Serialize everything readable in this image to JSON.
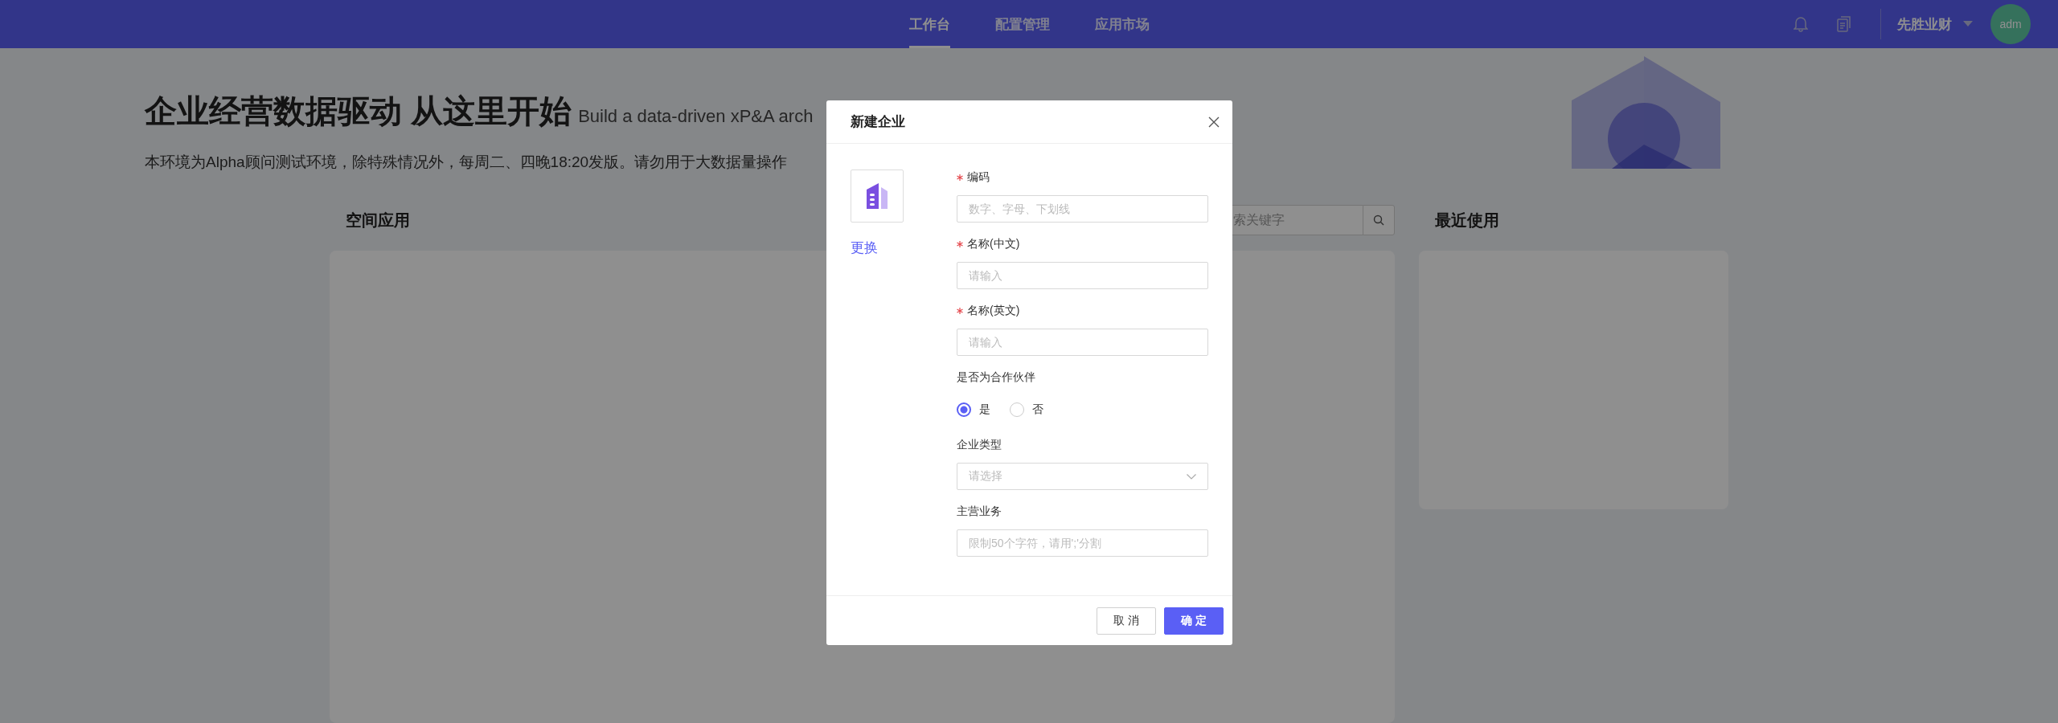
{
  "top_nav": {
    "tabs": [
      {
        "label": "工作台",
        "selected": true
      },
      {
        "label": "配置管理",
        "selected": false
      },
      {
        "label": "应用市场",
        "selected": false
      }
    ],
    "org": "先胜业财",
    "avatar": "adm"
  },
  "hero": {
    "title": "企业经营数据驱动 从这里开始",
    "subtitle": "Build a data-driven xP&A arch",
    "notice": "本环境为Alpha顾问测试环境，除特殊情况外，每周二、四晚18:20发版。请勿用于大数据量操作"
  },
  "space_apps": {
    "title": "空间应用",
    "search": {
      "placeholder": "索关键字"
    }
  },
  "recent": {
    "title": "最近使用"
  },
  "dialog": {
    "title": "新建企业",
    "change_link": "更换",
    "fields": [
      {
        "kind": "input",
        "label": "编码",
        "required": true,
        "placeholder": "数字、字母、下划线"
      },
      {
        "kind": "input",
        "label": "名称(中文)",
        "required": true,
        "placeholder": "请输入"
      },
      {
        "kind": "input",
        "label": "名称(英文)",
        "required": true,
        "placeholder": "请输入"
      },
      {
        "kind": "radio",
        "label": "是否为合作伙伴",
        "required": false,
        "options": [
          {
            "label": "是",
            "selected": true
          },
          {
            "label": "否",
            "selected": false
          }
        ]
      },
      {
        "kind": "select",
        "label": "企业类型",
        "required": false,
        "placeholder": "请选择"
      },
      {
        "kind": "input",
        "label": "主营业务",
        "required": false,
        "placeholder": "限制50个字符，请用';'分割"
      }
    ],
    "buttons": [
      {
        "label": "取 消",
        "kind": "default"
      },
      {
        "label": "确 定",
        "kind": "primary"
      }
    ]
  }
}
